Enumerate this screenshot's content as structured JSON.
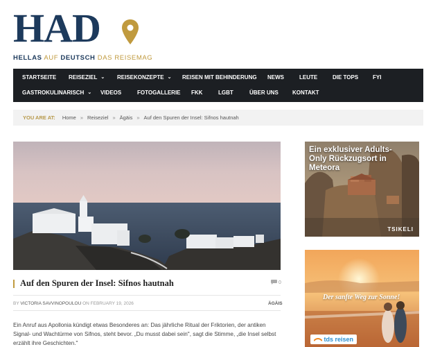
{
  "logo": {
    "wordmark": "HAD",
    "tag_bold1": "HELLAS",
    "tag_light1": "AUF",
    "tag_bold2": "DEUTSCH",
    "tag_light2": "DAS REISEMAG"
  },
  "nav": {
    "row1": [
      {
        "label": "STARTSEITE",
        "caret": false
      },
      {
        "label": "REISEZIEL",
        "caret": true
      },
      {
        "label": "REISEKONZEPTE",
        "caret": true
      },
      {
        "label": "REISEN MIT BEHINDERUNG",
        "caret": false
      },
      {
        "label": "NEWS",
        "caret": false
      },
      {
        "label": "LEUTE",
        "caret": false
      },
      {
        "label": "DIE TOPS",
        "caret": false
      },
      {
        "label": "FYI",
        "caret": false
      }
    ],
    "row2": [
      {
        "label": "GASTROKULINARISCH",
        "caret": true
      },
      {
        "label": "VIDEOS",
        "caret": false
      },
      {
        "label": "FOTOGALLERIE",
        "caret": false
      },
      {
        "label": "FKK",
        "caret": false
      },
      {
        "label": "LGBT",
        "caret": false
      },
      {
        "label": "ÜBER UNS",
        "caret": false
      },
      {
        "label": "KONTAKT",
        "caret": false
      }
    ],
    "caret_glyph": "⌄"
  },
  "breadcrumb": {
    "label": "YOU ARE AT:",
    "items": [
      "Home",
      "Reiseziel",
      "Ägäis",
      "Auf den Spuren der Insel: Sifnos hautnah"
    ],
    "separator": "»"
  },
  "article": {
    "title": "Auf den Spuren der Insel: Sifnos hautnah",
    "comments": "0",
    "comment_icon": "comment-icon",
    "by": "BY",
    "author": "VICTORIA SAVVINOPOULOU",
    "on": "ON",
    "date": "FEBRUARY 19, 2026",
    "category": "ÄGÄIS",
    "body": "Ein Anruf aus Apollonia kündigt etwas Besonderes an: Das jährliche Ritual der Friktorien, der antiken Signal- und Wachtürme von Sifnos, steht bevor. „Du musst dabei sein\", sagt die Stimme, „die Insel selbst erzählt ihre Geschichten.\""
  },
  "ads": {
    "ad1_title": "Ein exklusiver Adults-Only Rückzugsort in Meteora",
    "ad1_brand": "TSIKELI",
    "ad2_slogan": "Der sanfte Weg zur Sonne!",
    "ad2_brand": "tds reisen"
  },
  "colors": {
    "brand_navy": "#1d3a5c",
    "brand_gold": "#c09a3e",
    "nav_bg": "#1c1f23"
  }
}
